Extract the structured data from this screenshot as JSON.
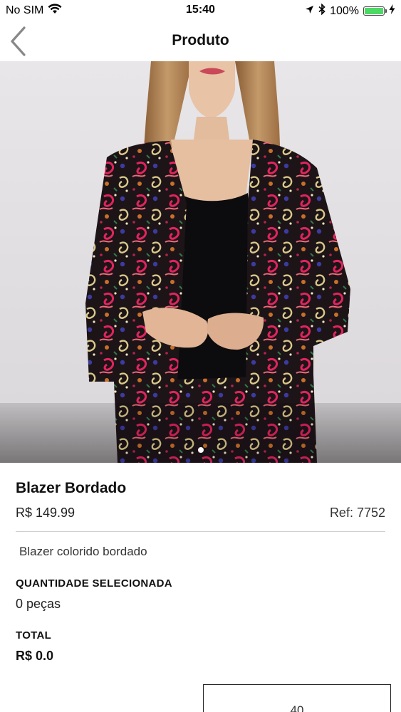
{
  "status_bar": {
    "carrier": "No SIM",
    "time": "15:40",
    "battery": "100%",
    "battery_level": 1.0
  },
  "nav": {
    "title": "Produto",
    "back_icon": "chevron-left-icon"
  },
  "carousel": {
    "page_count": 1,
    "active_index": 0
  },
  "product": {
    "name": "Blazer Bordado",
    "price": "R$ 149.99",
    "ref": "Ref: 7752",
    "description": "Blazer colorido bordado"
  },
  "quantity": {
    "label": "QUANTIDADE SELECIONADA",
    "value": "0 peças"
  },
  "total": {
    "label": "TOTAL",
    "value": "R$ 0.0"
  },
  "size_option": {
    "label": "40"
  },
  "colors": {
    "battery_green": "#4cd964",
    "background": "#ffffff",
    "image_background": "#e6e3e5"
  }
}
